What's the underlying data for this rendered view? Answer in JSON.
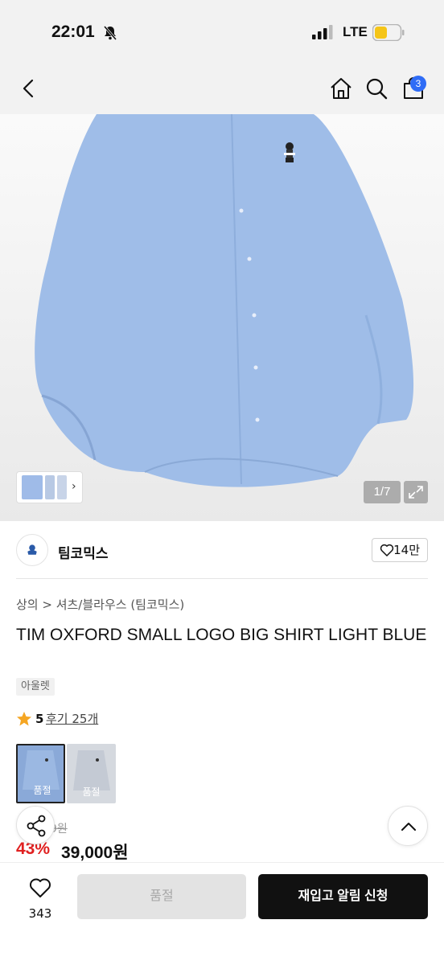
{
  "status_bar": {
    "time": "22:01",
    "network": "LTE"
  },
  "nav": {
    "cart_count": "3"
  },
  "hero": {
    "image_counter": "1/7"
  },
  "brand": {
    "name": "팀코믹스",
    "likes": "14만"
  },
  "breadcrumb": {
    "text": "상의 > 셔츠/블라우스 (팀코믹스)"
  },
  "product": {
    "title": "TIM OXFORD SMALL LOGO BIG SHIRT LIGHT BLUE",
    "tag": "아울렛",
    "rating": "5",
    "reviews": "후기 25개",
    "options": [
      {
        "label": "품절"
      },
      {
        "label": "품절"
      }
    ],
    "original_price": "9원",
    "discount": "43%",
    "price": "39,000원"
  },
  "bottom_bar": {
    "wish_count": "343",
    "soldout_label": "품절",
    "restock_label": "재입고 알림 신청"
  },
  "colors": {
    "accent": "#2f6cf6",
    "discount": "#e02020",
    "primary_button": "#111111",
    "shirt": "#9fbde8"
  },
  "icons": [
    "bell-off-icon",
    "signal-icon",
    "battery-icon",
    "back-icon",
    "home-icon",
    "search-icon",
    "cart-icon",
    "expand-icon",
    "chevron-right-icon",
    "heart-icon",
    "star-icon",
    "share-icon",
    "chevron-up-icon"
  ]
}
